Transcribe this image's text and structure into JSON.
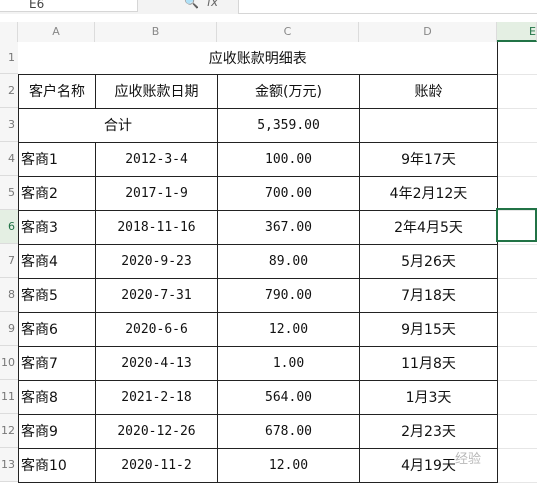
{
  "toolbar": {
    "name_box": "E6",
    "fx_label": "fx",
    "zoom_icon": "zoom-icon"
  },
  "columns": [
    "A",
    "B",
    "C",
    "D",
    "E"
  ],
  "row_numbers": [
    "1",
    "2",
    "3",
    "4",
    "5",
    "6",
    "7",
    "8",
    "9",
    "10",
    "11",
    "12",
    "13"
  ],
  "table": {
    "title": "应收账款明细表",
    "headers": [
      "客户名称",
      "应收账款日期",
      "金额(万元)",
      "账龄"
    ],
    "total_label": "合计",
    "total_amount": "5,359.00",
    "rows": [
      {
        "name": "客商1",
        "date": "2012-3-4",
        "amount": "100.00",
        "age": "9年17天"
      },
      {
        "name": "客商2",
        "date": "2017-1-9",
        "amount": "700.00",
        "age": "4年2月12天"
      },
      {
        "name": "客商3",
        "date": "2018-11-16",
        "amount": "367.00",
        "age": "2年4月5天"
      },
      {
        "name": "客商4",
        "date": "2020-9-23",
        "amount": "89.00",
        "age": "5月26天"
      },
      {
        "name": "客商5",
        "date": "2020-7-31",
        "amount": "790.00",
        "age": "7月18天"
      },
      {
        "name": "客商6",
        "date": "2020-6-6",
        "amount": "12.00",
        "age": "9月15天"
      },
      {
        "name": "客商7",
        "date": "2020-4-13",
        "amount": "1.00",
        "age": "11月8天"
      },
      {
        "name": "客商8",
        "date": "2021-2-18",
        "amount": "564.00",
        "age": "1月3天"
      },
      {
        "name": "客商9",
        "date": "2020-12-26",
        "amount": "678.00",
        "age": "2月23天"
      },
      {
        "name": "客商10",
        "date": "2020-11-2",
        "amount": "12.00",
        "age": "4月19天"
      }
    ]
  },
  "watermark": "经验"
}
